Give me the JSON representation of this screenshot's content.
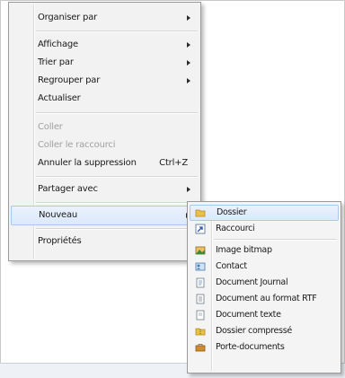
{
  "context_menu": {
    "items": [
      {
        "label": "Organiser par"
      },
      {
        "label": "Affichage"
      },
      {
        "label": "Trier par"
      },
      {
        "label": "Regrouper par"
      },
      {
        "label": "Actualiser"
      },
      {
        "label": "Coller"
      },
      {
        "label": "Coller le raccourci"
      },
      {
        "label": "Annuler la suppression",
        "shortcut": "Ctrl+Z"
      },
      {
        "label": "Partager avec"
      },
      {
        "label": "Nouveau"
      },
      {
        "label": "Propriétés"
      }
    ]
  },
  "new_submenu": {
    "items": [
      {
        "label": "Dossier",
        "icon": "folder-icon"
      },
      {
        "label": "Raccourci",
        "icon": "shortcut-icon"
      },
      {
        "label": "Image bitmap",
        "icon": "bitmap-image-icon"
      },
      {
        "label": "Contact",
        "icon": "contact-icon"
      },
      {
        "label": "Document Journal",
        "icon": "journal-document-icon"
      },
      {
        "label": "Document au format RTF",
        "icon": "rtf-document-icon"
      },
      {
        "label": "Document texte",
        "icon": "text-document-icon"
      },
      {
        "label": "Dossier compressé",
        "icon": "zip-folder-icon"
      },
      {
        "label": "Porte-documents",
        "icon": "briefcase-icon"
      }
    ]
  },
  "colors": {
    "menu_bg": "#f2f2f2",
    "hover_bg": "#dbe9fa",
    "hover_border": "#a8c8ee",
    "disabled_text": "#a0a0a0"
  }
}
